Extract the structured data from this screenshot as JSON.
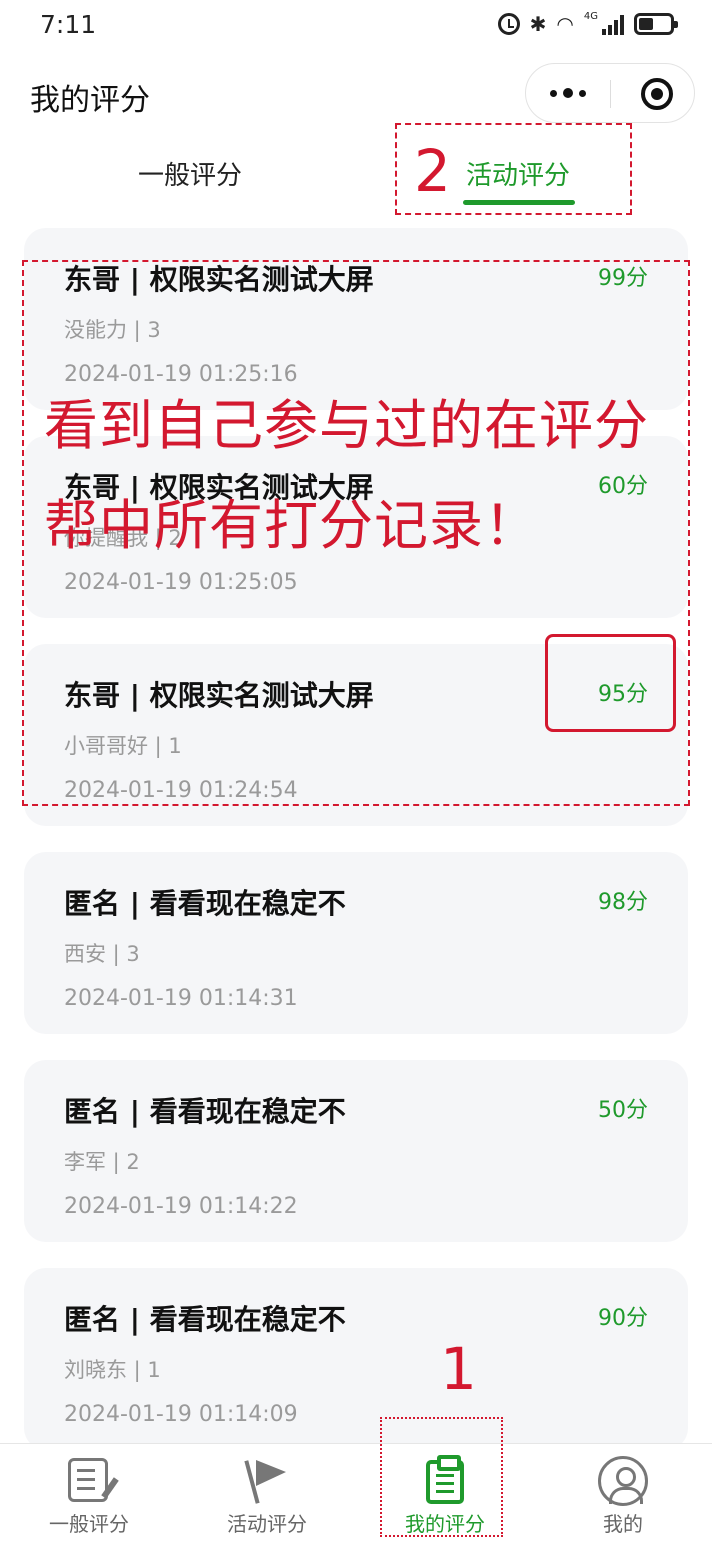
{
  "status_bar": {
    "time": "7:11",
    "network": "4G",
    "icons": [
      "alarm-icon",
      "bluetooth-icon",
      "wifi-icon",
      "signal-icon",
      "battery-icon"
    ]
  },
  "nav": {
    "title": "我的评分",
    "capsule_icons": [
      "more-icon",
      "close-miniprogram-icon"
    ]
  },
  "tabs": {
    "general": "一般评分",
    "activity": "活动评分",
    "active": "activity"
  },
  "records": [
    {
      "title": "东哥 | 权限实名测试大屏",
      "score": "99分",
      "sub": "没能力 | 3",
      "time": "2024-01-19 01:25:16"
    },
    {
      "title": "东哥 | 权限实名测试大屏",
      "score": "60分",
      "sub": "你提醒我 | 2",
      "time": "2024-01-19 01:25:05"
    },
    {
      "title": "东哥 | 权限实名测试大屏",
      "score": "95分",
      "sub": "小哥哥好 | 1",
      "time": "2024-01-19 01:24:54"
    },
    {
      "title": "匿名 | 看看现在稳定不",
      "score": "98分",
      "sub": "西安 | 3",
      "time": "2024-01-19 01:14:31"
    },
    {
      "title": "匿名 | 看看现在稳定不",
      "score": "50分",
      "sub": "李军 | 2",
      "time": "2024-01-19 01:14:22"
    },
    {
      "title": "匿名 | 看看现在稳定不",
      "score": "90分",
      "sub": "刘晓东 | 1",
      "time": "2024-01-19 01:14:09"
    }
  ],
  "annotations": {
    "step1": "1",
    "step2": "2",
    "note_line1": "看到自己参与过的在评分",
    "note_line2": "帮中所有打分记录！",
    "color": "#d3182f"
  },
  "tabbar": {
    "items": [
      {
        "label": "一般评分",
        "icon": "edit-note-icon"
      },
      {
        "label": "活动评分",
        "icon": "flag-icon"
      },
      {
        "label": "我的评分",
        "icon": "clipboard-icon"
      },
      {
        "label": "我的",
        "icon": "user-icon"
      }
    ],
    "active_index": 2
  },
  "colors": {
    "accent": "#1f9a2c",
    "card_bg": "#f5f6f8",
    "muted_text": "#9a9a9a"
  }
}
